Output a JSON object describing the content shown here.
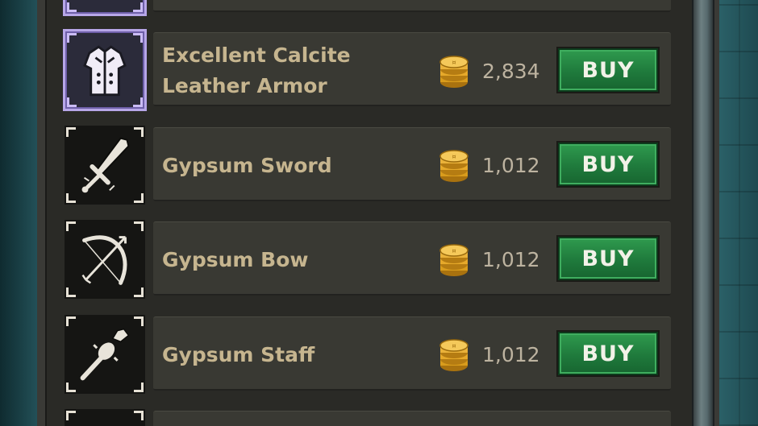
{
  "shop": {
    "currency_icon": "gold-coin-stack-icon",
    "items": [
      {
        "name": "Excellent Calcite Leather Armor",
        "price": "2,834",
        "buy_label": "BUY",
        "icon": "leather-armor-icon",
        "rarity_color": "#b7a6e8"
      },
      {
        "name": "Gypsum Sword",
        "price": "1,012",
        "buy_label": "BUY",
        "icon": "sword-icon"
      },
      {
        "name": "Gypsum Bow",
        "price": "1,012",
        "buy_label": "BUY",
        "icon": "bow-icon"
      },
      {
        "name": "Gypsum Staff",
        "price": "1,012",
        "buy_label": "BUY",
        "icon": "staff-icon"
      }
    ]
  },
  "colors": {
    "buy_button": "#1f7a3c",
    "item_name": "#c6b58f",
    "panel": "#2a2a26"
  }
}
